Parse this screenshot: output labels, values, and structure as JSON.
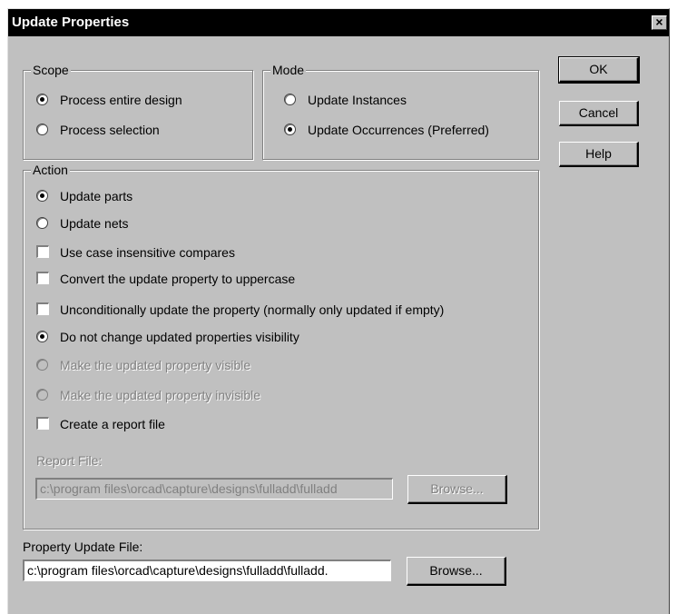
{
  "window": {
    "title": "Update Properties",
    "close_label": "×"
  },
  "scope": {
    "legend": "Scope",
    "options": [
      {
        "label": "Process entire design",
        "checked": true
      },
      {
        "label": "Process selection",
        "checked": false
      }
    ]
  },
  "mode": {
    "legend": "Mode",
    "options": [
      {
        "label": "Update Instances",
        "checked": false
      },
      {
        "label": "Update Occurrences (Preferred)",
        "checked": true
      }
    ]
  },
  "action": {
    "legend": "Action",
    "update_parts": "Update parts",
    "update_nets": "Update nets",
    "case_insensitive": "Use case insensitive compares",
    "uppercase": "Convert the update property to uppercase",
    "unconditional": "Unconditionally update the property (normally only updated if empty)",
    "no_change_visibility": "Do not change updated properties visibility",
    "make_visible": "Make the updated property visible",
    "make_invisible": "Make the updated property invisible",
    "create_report": "Create a report file",
    "report_file_label": "Report File:",
    "report_file_value": "c:\\program files\\orcad\\capture\\designs\\fulladd\\fulladd",
    "report_browse": "Browse..."
  },
  "property_file": {
    "label": "Property Update File:",
    "value": "c:\\program files\\orcad\\capture\\designs\\fulladd\\fulladd.",
    "browse": "Browse..."
  },
  "buttons": {
    "ok": "OK",
    "cancel": "Cancel",
    "help": "Help"
  }
}
